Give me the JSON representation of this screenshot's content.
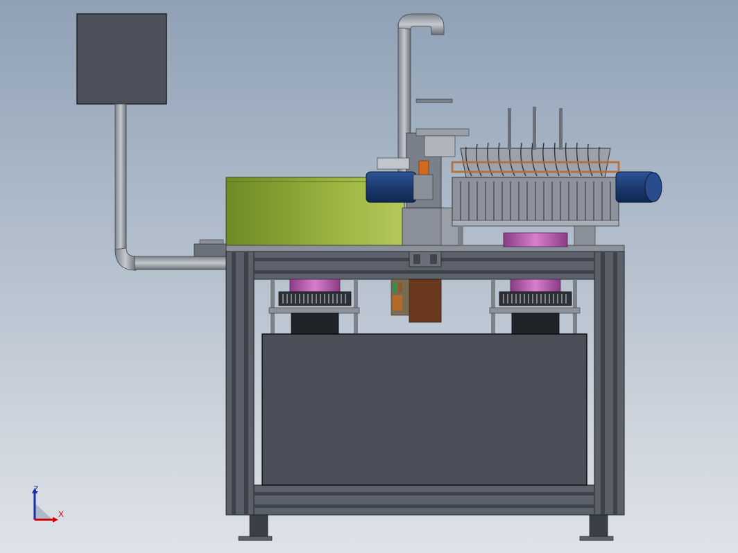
{
  "colors": {
    "frame": "#5b616b",
    "frame_dark": "#3d424b",
    "cabinet": "#4a4f59",
    "hopper": "#8aa43a",
    "motor": "#1d3f7a",
    "magenta": "#c05fb5",
    "copper": "#b8692c",
    "orange": "#d2691e",
    "triad_red": "#d10000",
    "triad_blue": "#1a2aa8",
    "triad_z": "#1a2aa8",
    "triad_x": "#d10000"
  },
  "triad": {
    "z_label": "Z",
    "x_label": "X"
  }
}
